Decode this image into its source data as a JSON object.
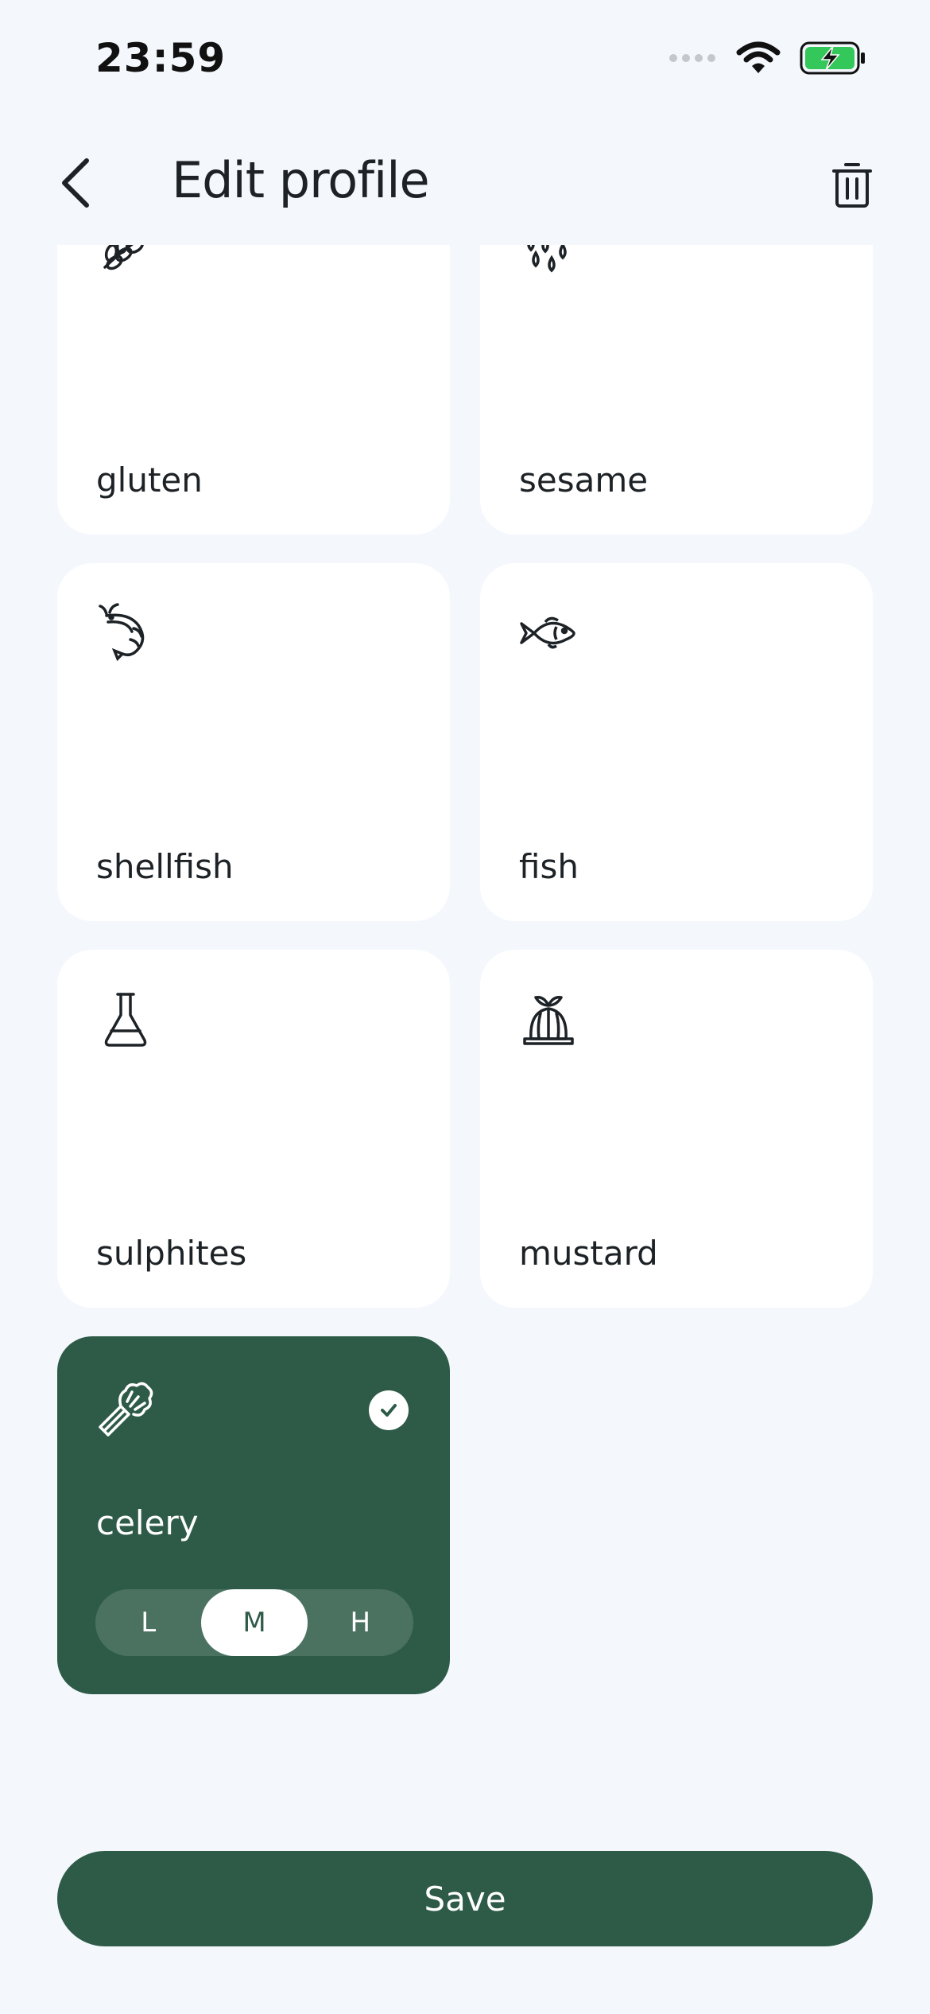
{
  "status_bar": {
    "time": "23:59",
    "icons": [
      "signal-dots-icon",
      "wifi-icon",
      "battery-charging-icon"
    ]
  },
  "header": {
    "title": "Edit profile",
    "back_icon": "chevron-left-icon",
    "delete_icon": "trash-icon"
  },
  "allergens": [
    {
      "label": "gluten",
      "icon": "wheat-icon",
      "selected": false
    },
    {
      "label": "sesame",
      "icon": "seeds-icon",
      "selected": false
    },
    {
      "label": "shellfish",
      "icon": "shrimp-icon",
      "selected": false
    },
    {
      "label": "fish",
      "icon": "fish-icon",
      "selected": false
    },
    {
      "label": "sulphites",
      "icon": "flask-icon",
      "selected": false
    },
    {
      "label": "mustard",
      "icon": "jelly-mould-icon",
      "selected": false
    },
    {
      "label": "celery",
      "icon": "celery-icon",
      "selected": true
    }
  ],
  "level_toggle": {
    "options": [
      "L",
      "M",
      "H"
    ],
    "selected": "M"
  },
  "save_label": "Save",
  "colors": {
    "background": "#f4f8fd",
    "card": "#ffffff",
    "accent": "#2e5b47",
    "battery": "#34c759"
  }
}
